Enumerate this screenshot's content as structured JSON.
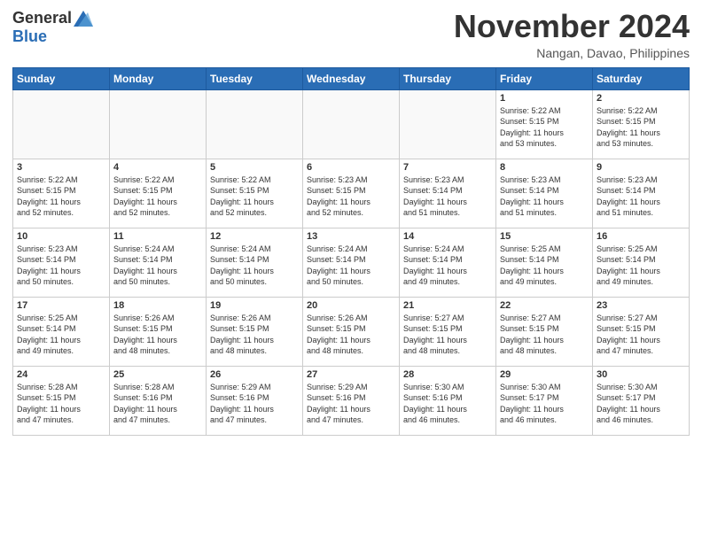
{
  "logo": {
    "general": "General",
    "blue": "Blue"
  },
  "title": "November 2024",
  "location": "Nangan, Davao, Philippines",
  "weekdays": [
    "Sunday",
    "Monday",
    "Tuesday",
    "Wednesday",
    "Thursday",
    "Friday",
    "Saturday"
  ],
  "weeks": [
    [
      {
        "day": "",
        "info": ""
      },
      {
        "day": "",
        "info": ""
      },
      {
        "day": "",
        "info": ""
      },
      {
        "day": "",
        "info": ""
      },
      {
        "day": "",
        "info": ""
      },
      {
        "day": "1",
        "info": "Sunrise: 5:22 AM\nSunset: 5:15 PM\nDaylight: 11 hours\nand 53 minutes."
      },
      {
        "day": "2",
        "info": "Sunrise: 5:22 AM\nSunset: 5:15 PM\nDaylight: 11 hours\nand 53 minutes."
      }
    ],
    [
      {
        "day": "3",
        "info": "Sunrise: 5:22 AM\nSunset: 5:15 PM\nDaylight: 11 hours\nand 52 minutes."
      },
      {
        "day": "4",
        "info": "Sunrise: 5:22 AM\nSunset: 5:15 PM\nDaylight: 11 hours\nand 52 minutes."
      },
      {
        "day": "5",
        "info": "Sunrise: 5:22 AM\nSunset: 5:15 PM\nDaylight: 11 hours\nand 52 minutes."
      },
      {
        "day": "6",
        "info": "Sunrise: 5:23 AM\nSunset: 5:15 PM\nDaylight: 11 hours\nand 52 minutes."
      },
      {
        "day": "7",
        "info": "Sunrise: 5:23 AM\nSunset: 5:14 PM\nDaylight: 11 hours\nand 51 minutes."
      },
      {
        "day": "8",
        "info": "Sunrise: 5:23 AM\nSunset: 5:14 PM\nDaylight: 11 hours\nand 51 minutes."
      },
      {
        "day": "9",
        "info": "Sunrise: 5:23 AM\nSunset: 5:14 PM\nDaylight: 11 hours\nand 51 minutes."
      }
    ],
    [
      {
        "day": "10",
        "info": "Sunrise: 5:23 AM\nSunset: 5:14 PM\nDaylight: 11 hours\nand 50 minutes."
      },
      {
        "day": "11",
        "info": "Sunrise: 5:24 AM\nSunset: 5:14 PM\nDaylight: 11 hours\nand 50 minutes."
      },
      {
        "day": "12",
        "info": "Sunrise: 5:24 AM\nSunset: 5:14 PM\nDaylight: 11 hours\nand 50 minutes."
      },
      {
        "day": "13",
        "info": "Sunrise: 5:24 AM\nSunset: 5:14 PM\nDaylight: 11 hours\nand 50 minutes."
      },
      {
        "day": "14",
        "info": "Sunrise: 5:24 AM\nSunset: 5:14 PM\nDaylight: 11 hours\nand 49 minutes."
      },
      {
        "day": "15",
        "info": "Sunrise: 5:25 AM\nSunset: 5:14 PM\nDaylight: 11 hours\nand 49 minutes."
      },
      {
        "day": "16",
        "info": "Sunrise: 5:25 AM\nSunset: 5:14 PM\nDaylight: 11 hours\nand 49 minutes."
      }
    ],
    [
      {
        "day": "17",
        "info": "Sunrise: 5:25 AM\nSunset: 5:14 PM\nDaylight: 11 hours\nand 49 minutes."
      },
      {
        "day": "18",
        "info": "Sunrise: 5:26 AM\nSunset: 5:15 PM\nDaylight: 11 hours\nand 48 minutes."
      },
      {
        "day": "19",
        "info": "Sunrise: 5:26 AM\nSunset: 5:15 PM\nDaylight: 11 hours\nand 48 minutes."
      },
      {
        "day": "20",
        "info": "Sunrise: 5:26 AM\nSunset: 5:15 PM\nDaylight: 11 hours\nand 48 minutes."
      },
      {
        "day": "21",
        "info": "Sunrise: 5:27 AM\nSunset: 5:15 PM\nDaylight: 11 hours\nand 48 minutes."
      },
      {
        "day": "22",
        "info": "Sunrise: 5:27 AM\nSunset: 5:15 PM\nDaylight: 11 hours\nand 48 minutes."
      },
      {
        "day": "23",
        "info": "Sunrise: 5:27 AM\nSunset: 5:15 PM\nDaylight: 11 hours\nand 47 minutes."
      }
    ],
    [
      {
        "day": "24",
        "info": "Sunrise: 5:28 AM\nSunset: 5:15 PM\nDaylight: 11 hours\nand 47 minutes."
      },
      {
        "day": "25",
        "info": "Sunrise: 5:28 AM\nSunset: 5:16 PM\nDaylight: 11 hours\nand 47 minutes."
      },
      {
        "day": "26",
        "info": "Sunrise: 5:29 AM\nSunset: 5:16 PM\nDaylight: 11 hours\nand 47 minutes."
      },
      {
        "day": "27",
        "info": "Sunrise: 5:29 AM\nSunset: 5:16 PM\nDaylight: 11 hours\nand 47 minutes."
      },
      {
        "day": "28",
        "info": "Sunrise: 5:30 AM\nSunset: 5:16 PM\nDaylight: 11 hours\nand 46 minutes."
      },
      {
        "day": "29",
        "info": "Sunrise: 5:30 AM\nSunset: 5:17 PM\nDaylight: 11 hours\nand 46 minutes."
      },
      {
        "day": "30",
        "info": "Sunrise: 5:30 AM\nSunset: 5:17 PM\nDaylight: 11 hours\nand 46 minutes."
      }
    ]
  ]
}
